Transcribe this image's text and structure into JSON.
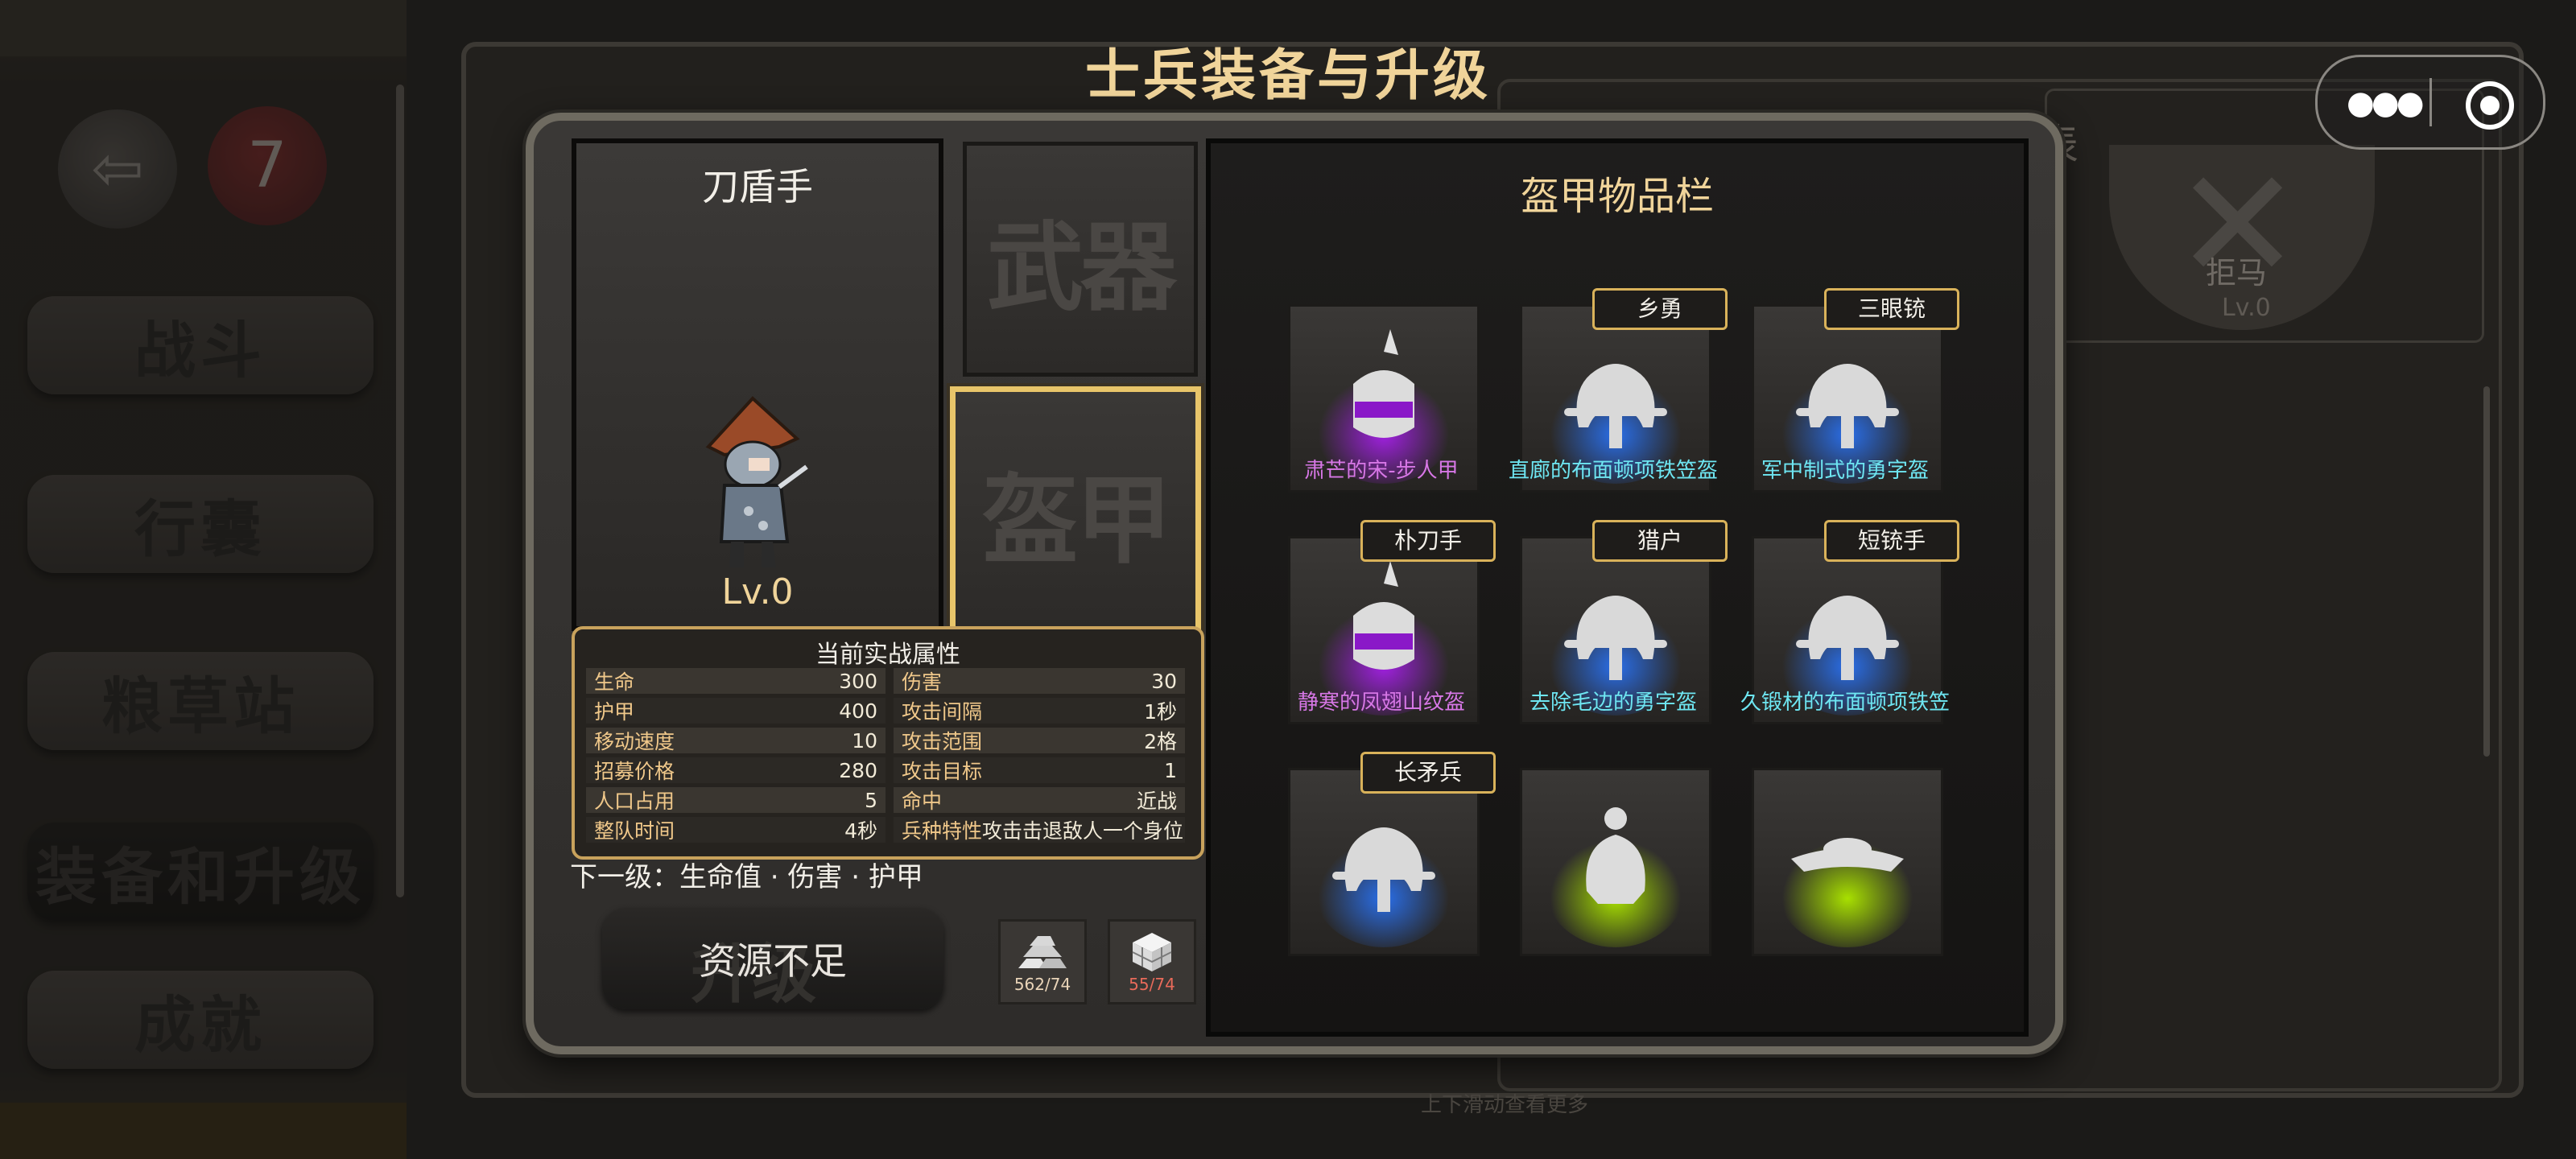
{
  "title": "士兵装备与升级",
  "nav": {
    "items": [
      "战斗",
      "行囊",
      "粮草站",
      "装备和升级",
      "成就"
    ],
    "calendar_day": "7"
  },
  "background": {
    "title_fragment": "表",
    "horse_name": "拒马",
    "horse_level": "Lv.0",
    "scroll_hint": "上下滑动查看更多"
  },
  "soldier": {
    "name": "刀盾手",
    "level": "Lv.0"
  },
  "slots": {
    "weapon": "武器",
    "armor": "盔甲"
  },
  "stats": {
    "title": "当前实战属性",
    "left": [
      {
        "k": "生命",
        "v": "300"
      },
      {
        "k": "护甲",
        "v": "400"
      },
      {
        "k": "移动速度",
        "v": "10"
      },
      {
        "k": "招募价格",
        "v": "280"
      },
      {
        "k": "人口占用",
        "v": "5"
      },
      {
        "k": "整队时间",
        "v": "4秒"
      }
    ],
    "right": [
      {
        "k": "伤害",
        "v": "30"
      },
      {
        "k": "攻击间隔",
        "v": "1秒"
      },
      {
        "k": "攻击范围",
        "v": "2格"
      },
      {
        "k": "攻击目标",
        "v": "1"
      },
      {
        "k": "命中",
        "v": "近战"
      },
      {
        "k": "兵种特性",
        "v": "攻击击退敌人一个身位"
      }
    ]
  },
  "next_level": "下一级：生命值 · 伤害 · 护甲",
  "upgrade": {
    "label": "资源不足",
    "ghost": "升级"
  },
  "resources": {
    "iron": "562/74",
    "stone": "55/74",
    "iron_color": "#e9d4b8",
    "stone_color": "#e86a5a"
  },
  "inventory": {
    "title": "盔甲物品栏",
    "items": [
      {
        "name": "肃芒的宋-步人甲",
        "tag": "",
        "color": "#d777e6",
        "glow": "#a020e0",
        "icon": "purple-helmet-icon"
      },
      {
        "name": "直廊的布面顿项铁笠盔",
        "tag": "乡勇",
        "color": "#6ee6f2",
        "glow": "#2a6ee8",
        "icon": "blue-helmet-icon"
      },
      {
        "name": "军中制式的勇字盔",
        "tag": "三眼铳",
        "color": "#6ee6f2",
        "glow": "#2a6ee8",
        "icon": "blue-helmet-icon"
      },
      {
        "name": "静寒的凤翅山纹盔",
        "tag": "朴刀手",
        "color": "#d777e6",
        "glow": "#a020e0",
        "icon": "purple-helmet-icon"
      },
      {
        "name": "去除毛边的勇字盔",
        "tag": "猎户",
        "color": "#6ee6f2",
        "glow": "#2a6ee8",
        "icon": "blue-helmet-icon"
      },
      {
        "name": "久锻材的布面顿项铁笠",
        "tag": "短铳手",
        "color": "#6ee6f2",
        "glow": "#2a6ee8",
        "icon": "blue-helmet-icon"
      },
      {
        "name": "",
        "tag": "长矛兵",
        "color": "#6ee6f2",
        "glow": "#2a6ee8",
        "icon": "blue-helmet-icon"
      },
      {
        "name": "",
        "tag": "",
        "color": "#b6e000",
        "glow": "#a8e000",
        "icon": "green-helmet-icon"
      },
      {
        "name": "",
        "tag": "",
        "color": "#b6e000",
        "glow": "#a8e000",
        "icon": "green-hat-icon"
      }
    ]
  }
}
